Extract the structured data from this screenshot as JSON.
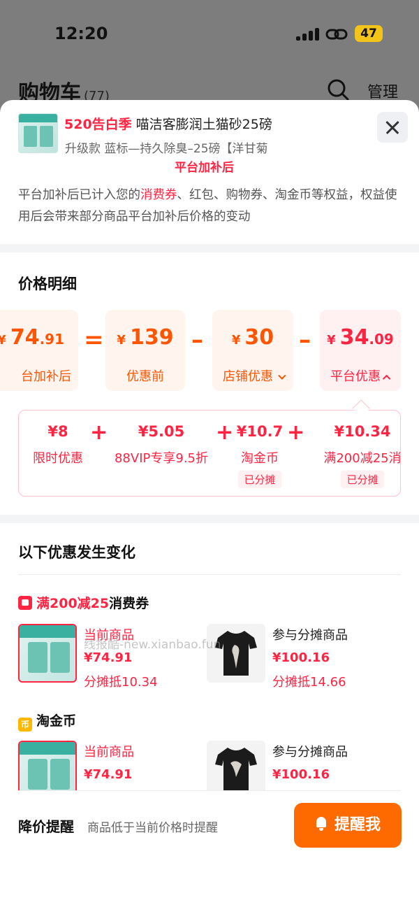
{
  "status_bar": {
    "time": "12:20",
    "battery": "47"
  },
  "cart_header": {
    "title": "购物车",
    "count": "(77)",
    "manage": "管理"
  },
  "product": {
    "promo_tag": "520告白季",
    "name": "喵洁客膨润土猫砂25磅",
    "spec": "升级款 蓝标—持久除臭–25磅【洋甘菊",
    "status": "平台加补后"
  },
  "description": {
    "part1": "平台加补后已计入您的",
    "highlight": "消费券",
    "part2": "、红包、购物券、淘金币等权益，权益使用后会带来部分商品平台加补后价格的变动"
  },
  "price_detail": {
    "title": "价格明细",
    "currency": "¥",
    "final": {
      "int": "74",
      "dec": ".91",
      "label": "台加补后"
    },
    "original": {
      "int": "139",
      "label": "优惠前"
    },
    "shop_discount": {
      "int": "30",
      "label": "店铺优惠"
    },
    "platform_discount": {
      "int": "34",
      "dec": ".09",
      "label": "平台优惠"
    },
    "op_equals": "=",
    "op_minus": "–"
  },
  "breakdown": [
    {
      "amount": "¥8",
      "label": "限时优惠",
      "badge": ""
    },
    {
      "amount": "¥5.05",
      "label": "88VIP专享9.5折",
      "badge": ""
    },
    {
      "amount": "¥10.7",
      "label": "淘金币",
      "badge": "已分摊"
    },
    {
      "amount": "¥10.34",
      "label": "满200减25消",
      "badge": "已分摊"
    }
  ],
  "changes": {
    "title": "以下优惠发生变化",
    "coupon": {
      "name_prefix": "满200减25",
      "name_suffix": "消费券",
      "current": {
        "label": "当前商品",
        "price": "¥74.91",
        "share": "分摊抵10.34"
      },
      "other": {
        "label": "参与分摊商品",
        "price": "¥100.16",
        "share": "分摊抵14.66"
      }
    },
    "coins": {
      "name": "淘金币",
      "icon_glyph": "币",
      "current": {
        "label": "当前商品",
        "price": "¥74.91"
      },
      "other": {
        "label": "参与分摊商品",
        "price": "¥100.16"
      }
    }
  },
  "watermark": "线报酷-new.xianbao.fun",
  "price_alert": {
    "title": "降价提醒",
    "subtitle": "商品低于当前价格时提醒",
    "button": "提醒我"
  },
  "colors": {
    "accent_red": "#ff2442",
    "accent_orange": "#ff5500",
    "button_orange": "#ff6a00"
  }
}
